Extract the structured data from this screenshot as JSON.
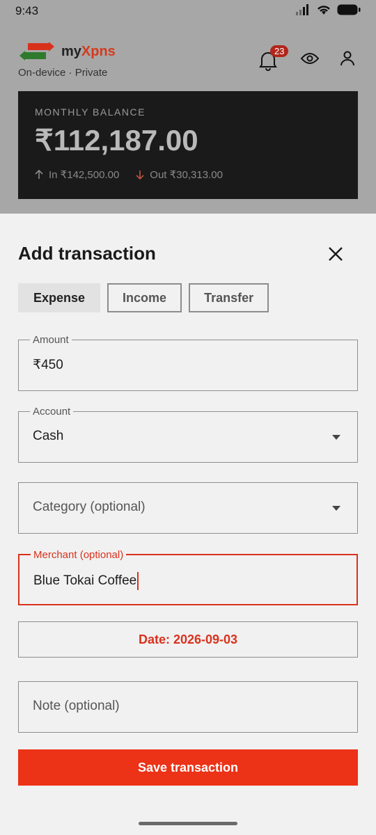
{
  "status": {
    "time": "9:43"
  },
  "header": {
    "brand_prefix": "my",
    "brand_accent": "Xpns",
    "subtitle": "On-device · Private",
    "notification_count": "23"
  },
  "balance": {
    "label": "MONTHLY BALANCE",
    "amount": "₹112,187.00",
    "in_text": "In ₹142,500.00",
    "out_text": "Out ₹30,313.00"
  },
  "sheet": {
    "title": "Add transaction",
    "type_tabs": [
      {
        "label": "Expense",
        "active": true
      },
      {
        "label": "Income",
        "active": false
      },
      {
        "label": "Transfer",
        "active": false
      }
    ],
    "amount": {
      "legend": "Amount",
      "value": "₹450"
    },
    "account": {
      "legend": "Account",
      "value": "Cash"
    },
    "category": {
      "placeholder": "Category (optional)"
    },
    "merchant": {
      "legend": "Merchant (optional)",
      "value": "Blue Tokai Coffee"
    },
    "date_label": "Date: 2026-09-03",
    "note": {
      "placeholder": "Note (optional)"
    },
    "save_label": "Save transaction"
  },
  "colors": {
    "accent": "#ec3217",
    "focus_border": "#d8321d",
    "badge": "#b1261a",
    "card_bg": "#1b1a1a"
  },
  "icons": [
    "signal-icon",
    "wifi-icon",
    "battery-icon",
    "logo-arrows-icon",
    "bell-icon",
    "eye-icon",
    "user-icon",
    "arrow-up-icon",
    "arrow-down-icon",
    "close-icon",
    "chevron-down-icon"
  ]
}
